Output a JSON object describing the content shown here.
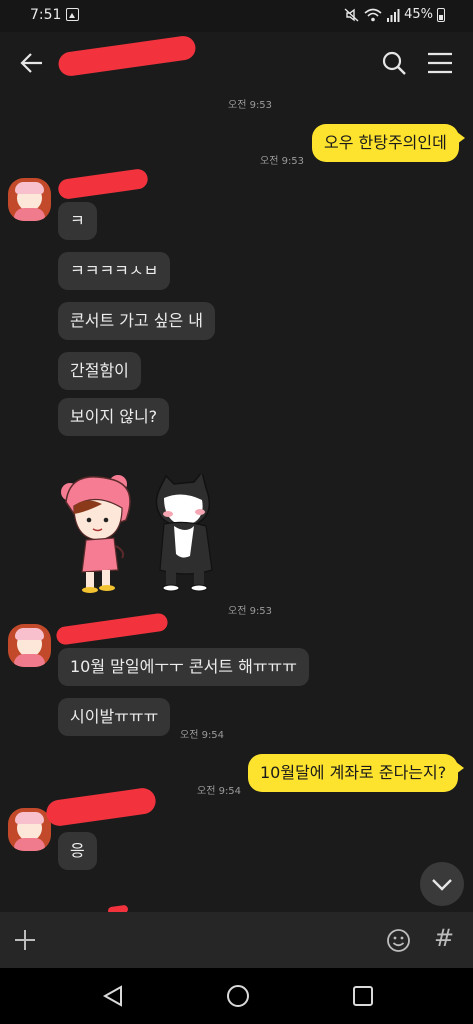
{
  "status_bar": {
    "time": "7:51",
    "battery": "45%"
  },
  "header": {
    "back_icon": "arrow-left-icon",
    "search_icon": "search-icon",
    "menu_icon": "hamburger-menu-icon"
  },
  "chat": {
    "timestamps": {
      "t1": "오전 9:53",
      "t2": "오전 9:53",
      "t3": "오전 9:53",
      "t4": "오전 9:54",
      "t5": "오전 9:54"
    },
    "messages": {
      "m1": "오우 한탕주의인데",
      "m2": "ㅋ",
      "m3": "ㅋㅋㅋㅋㅅㅂ",
      "m4": "콘서트 가고 싶은 내",
      "m5": "간절함이",
      "m6": "보이지 않니?",
      "m7": "10월 말일에ㅜㅜ 콘서트 해ㅠㅠㅠ",
      "m8": "시이발ㅠㅠㅠ",
      "m9": "10월달에 계좌로 준다는지?",
      "m10": "응"
    }
  },
  "input_bar": {
    "hash": "#"
  },
  "colors": {
    "bubble_out": "#fde32d",
    "bubble_in": "#353535",
    "background": "#1b1b1b",
    "redaction": "#f2333e"
  }
}
